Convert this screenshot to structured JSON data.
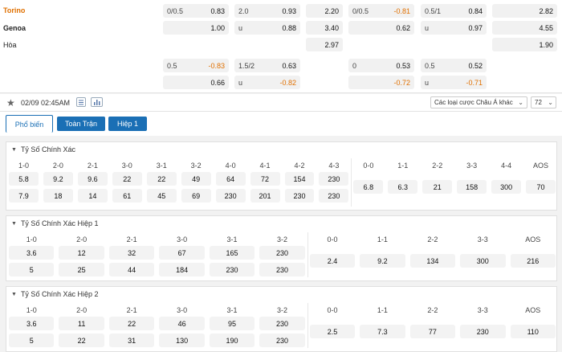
{
  "match": {
    "home": "Torino",
    "away": "Genoa",
    "draw": "Hòa"
  },
  "odds_row1": [
    {
      "l": "0/0.5",
      "r": "0.83"
    },
    {
      "l": "2.0",
      "r": "0.93"
    },
    {
      "l": "",
      "r": "2.20"
    },
    {
      "l": "0/0.5",
      "r": "-0.81"
    },
    {
      "l": "0.5/1",
      "r": "0.84"
    },
    {
      "l": "",
      "r": "2.82"
    }
  ],
  "odds_row2": [
    {
      "l": "",
      "r": "1.00"
    },
    {
      "l": "u",
      "r": "0.88"
    },
    {
      "l": "",
      "r": "3.40"
    },
    {
      "l": "",
      "r": "0.62"
    },
    {
      "l": "u",
      "r": "0.97"
    },
    {
      "l": "",
      "r": "4.55"
    }
  ],
  "odds_row3": [
    {
      "l": "",
      "r": "2.97"
    },
    {
      "l": "",
      "r": "1.90"
    }
  ],
  "odds_row4": [
    {
      "l": "0.5",
      "r": "-0.83"
    },
    {
      "l": "1.5/2",
      "r": "0.63"
    },
    {
      "l": "0",
      "r": "0.53"
    },
    {
      "l": "0.5",
      "r": "0.52"
    }
  ],
  "odds_row5": [
    {
      "l": "",
      "r": "0.66"
    },
    {
      "l": "u",
      "r": "-0.82"
    },
    {
      "l": "",
      "r": "-0.72"
    },
    {
      "l": "u",
      "r": "-0.71"
    }
  ],
  "bar": {
    "date": "02/09 02:45AM",
    "select": "Các loại cược Châu Á khác",
    "count": "72"
  },
  "tabs": [
    "Phổ biến",
    "Toàn Trận",
    "Hiệp 1"
  ],
  "s1": {
    "title": "Tỷ Số Chính Xác",
    "headers": [
      "1-0",
      "2-0",
      "2-1",
      "3-0",
      "3-1",
      "3-2",
      "4-0",
      "4-1",
      "4-2",
      "4-3",
      "0-0",
      "1-1",
      "2-2",
      "3-3",
      "4-4",
      "AOS"
    ],
    "row1": [
      "5.8",
      "9.2",
      "9.6",
      "22",
      "22",
      "49",
      "64",
      "72",
      "154",
      "230"
    ],
    "row2": [
      "7.9",
      "18",
      "14",
      "61",
      "45",
      "69",
      "230",
      "201",
      "230",
      "230"
    ],
    "mid": [
      "6.8",
      "6.3",
      "21",
      "158",
      "300",
      "70"
    ]
  },
  "s2": {
    "title": "Tỷ Số Chính Xác Hiệp 1",
    "headers": [
      "1-0",
      "2-0",
      "2-1",
      "3-0",
      "3-1",
      "3-2",
      "0-0",
      "1-1",
      "2-2",
      "3-3",
      "AOS"
    ],
    "row1": [
      "3.6",
      "12",
      "32",
      "67",
      "165",
      "230"
    ],
    "row2": [
      "5",
      "25",
      "44",
      "184",
      "230",
      "230"
    ],
    "mid": [
      "2.4",
      "9.2",
      "134",
      "300",
      "216"
    ]
  },
  "s3": {
    "title": "Tỷ Số Chính Xác Hiệp 2",
    "headers": [
      "1-0",
      "2-0",
      "2-1",
      "3-0",
      "3-1",
      "3-2",
      "0-0",
      "1-1",
      "2-2",
      "3-3",
      "AOS"
    ],
    "row1": [
      "3.6",
      "11",
      "22",
      "46",
      "95",
      "230"
    ],
    "row2": [
      "5",
      "22",
      "31",
      "130",
      "190",
      "230"
    ],
    "mid": [
      "2.5",
      "7.3",
      "77",
      "230",
      "110"
    ]
  }
}
